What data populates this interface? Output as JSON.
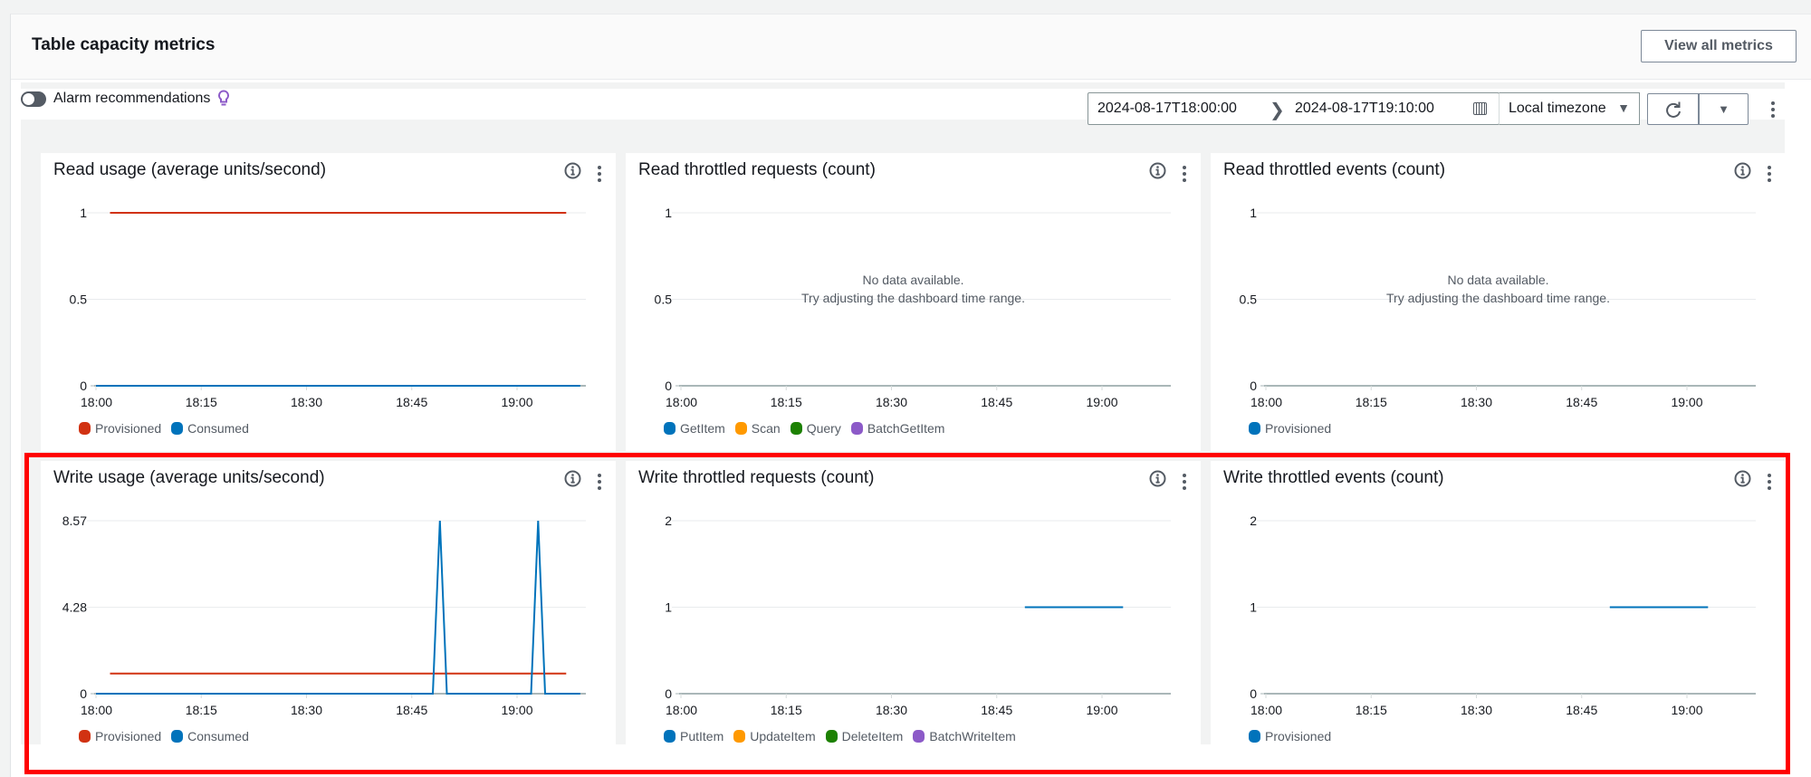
{
  "header": {
    "title": "Table capacity metrics",
    "view_all_label": "View all metrics"
  },
  "toolbar": {
    "alarm_toggle_label": "Alarm recommendations",
    "alarm_toggle_on": false,
    "date_from": "2024-08-17T18:00:00",
    "date_to": "2024-08-17T19:10:00",
    "timezone": "Local timezone",
    "icons": [
      "toggle-icon",
      "lightbulb-icon",
      "chevron-right-icon",
      "calendar-icon",
      "caret-down-icon",
      "refresh-icon",
      "caret-down-icon",
      "kebab-icon"
    ]
  },
  "colors": {
    "provisioned_red": "#d13212",
    "consumed_blue": "#0073bb",
    "orange": "#ff9900",
    "green": "#1d8102",
    "purple": "#8c5ac8",
    "highlight_red": "#ff0000"
  },
  "no_data": {
    "line1": "No data available.",
    "line2": "Try adjusting the dashboard time range."
  },
  "chart_data": [
    {
      "id": "read-usage",
      "type": "line",
      "title": "Read usage (average units/second)",
      "xlabel": "",
      "ylabel": "",
      "x_ticks": [
        "18:00",
        "18:15",
        "18:30",
        "18:45",
        "19:00"
      ],
      "x_range_minutes": [
        0,
        70
      ],
      "y_ticks": [
        "0",
        "0.5",
        "1"
      ],
      "ylim": [
        0,
        1
      ],
      "grid": true,
      "legend_position": "bottom-left",
      "series": [
        {
          "name": "Provisioned",
          "color": "#d13212",
          "points": [
            [
              2,
              1
            ],
            [
              67,
              1
            ]
          ]
        },
        {
          "name": "Consumed",
          "color": "#0073bb",
          "points": [
            [
              0,
              0
            ],
            [
              69,
              0
            ]
          ]
        }
      ]
    },
    {
      "id": "read-throttled-requests",
      "type": "line",
      "title": "Read throttled requests (count)",
      "xlabel": "",
      "ylabel": "",
      "x_ticks": [
        "18:00",
        "18:15",
        "18:30",
        "18:45",
        "19:00"
      ],
      "x_range_minutes": [
        0,
        70
      ],
      "y_ticks": [
        "0",
        "0.5",
        "1"
      ],
      "ylim": [
        0,
        1
      ],
      "grid": true,
      "no_data": true,
      "legend_position": "bottom-left",
      "series": [
        {
          "name": "GetItem",
          "color": "#0073bb",
          "points": []
        },
        {
          "name": "Scan",
          "color": "#ff9900",
          "points": []
        },
        {
          "name": "Query",
          "color": "#1d8102",
          "points": []
        },
        {
          "name": "BatchGetItem",
          "color": "#8c5ac8",
          "points": []
        }
      ]
    },
    {
      "id": "read-throttled-events",
      "type": "line",
      "title": "Read throttled events (count)",
      "xlabel": "",
      "ylabel": "",
      "x_ticks": [
        "18:00",
        "18:15",
        "18:30",
        "18:45",
        "19:00"
      ],
      "x_range_minutes": [
        0,
        70
      ],
      "y_ticks": [
        "0",
        "0.5",
        "1"
      ],
      "ylim": [
        0,
        1
      ],
      "grid": true,
      "no_data": true,
      "legend_position": "bottom-left",
      "series": [
        {
          "name": "Provisioned",
          "color": "#0073bb",
          "points": []
        }
      ]
    },
    {
      "id": "write-usage",
      "type": "line",
      "title": "Write usage (average units/second)",
      "xlabel": "",
      "ylabel": "",
      "x_ticks": [
        "18:00",
        "18:15",
        "18:30",
        "18:45",
        "19:00"
      ],
      "x_range_minutes": [
        0,
        70
      ],
      "y_ticks": [
        "0",
        "4.28",
        "8.57"
      ],
      "ylim": [
        0,
        8.57
      ],
      "grid": true,
      "legend_position": "bottom-left",
      "series": [
        {
          "name": "Provisioned",
          "color": "#d13212",
          "points": [
            [
              2,
              1
            ],
            [
              67,
              1
            ]
          ]
        },
        {
          "name": "Consumed",
          "color": "#0073bb",
          "points": [
            [
              0,
              0
            ],
            [
              48,
              0
            ],
            [
              49,
              8.57
            ],
            [
              50,
              0
            ],
            [
              62,
              0
            ],
            [
              63,
              8.57
            ],
            [
              64,
              0
            ],
            [
              69,
              0
            ]
          ]
        }
      ]
    },
    {
      "id": "write-throttled-requests",
      "type": "line",
      "title": "Write throttled requests (count)",
      "xlabel": "",
      "ylabel": "",
      "x_ticks": [
        "18:00",
        "18:15",
        "18:30",
        "18:45",
        "19:00"
      ],
      "x_range_minutes": [
        0,
        70
      ],
      "y_ticks": [
        "0",
        "1",
        "2"
      ],
      "ylim": [
        0,
        2
      ],
      "grid": true,
      "legend_position": "bottom-left",
      "series": [
        {
          "name": "PutItem",
          "color": "#0073bb",
          "points": [
            [
              49,
              1
            ],
            [
              63,
              1
            ]
          ]
        },
        {
          "name": "UpdateItem",
          "color": "#ff9900",
          "points": []
        },
        {
          "name": "DeleteItem",
          "color": "#1d8102",
          "points": []
        },
        {
          "name": "BatchWriteItem",
          "color": "#8c5ac8",
          "points": []
        }
      ]
    },
    {
      "id": "write-throttled-events",
      "type": "line",
      "title": "Write throttled events (count)",
      "xlabel": "",
      "ylabel": "",
      "x_ticks": [
        "18:00",
        "18:15",
        "18:30",
        "18:45",
        "19:00"
      ],
      "x_range_minutes": [
        0,
        70
      ],
      "y_ticks": [
        "0",
        "1",
        "2"
      ],
      "ylim": [
        0,
        2
      ],
      "grid": true,
      "legend_position": "bottom-left",
      "series": [
        {
          "name": "Provisioned",
          "color": "#0073bb",
          "points": [
            [
              49,
              1
            ],
            [
              63,
              1
            ]
          ]
        }
      ]
    }
  ]
}
